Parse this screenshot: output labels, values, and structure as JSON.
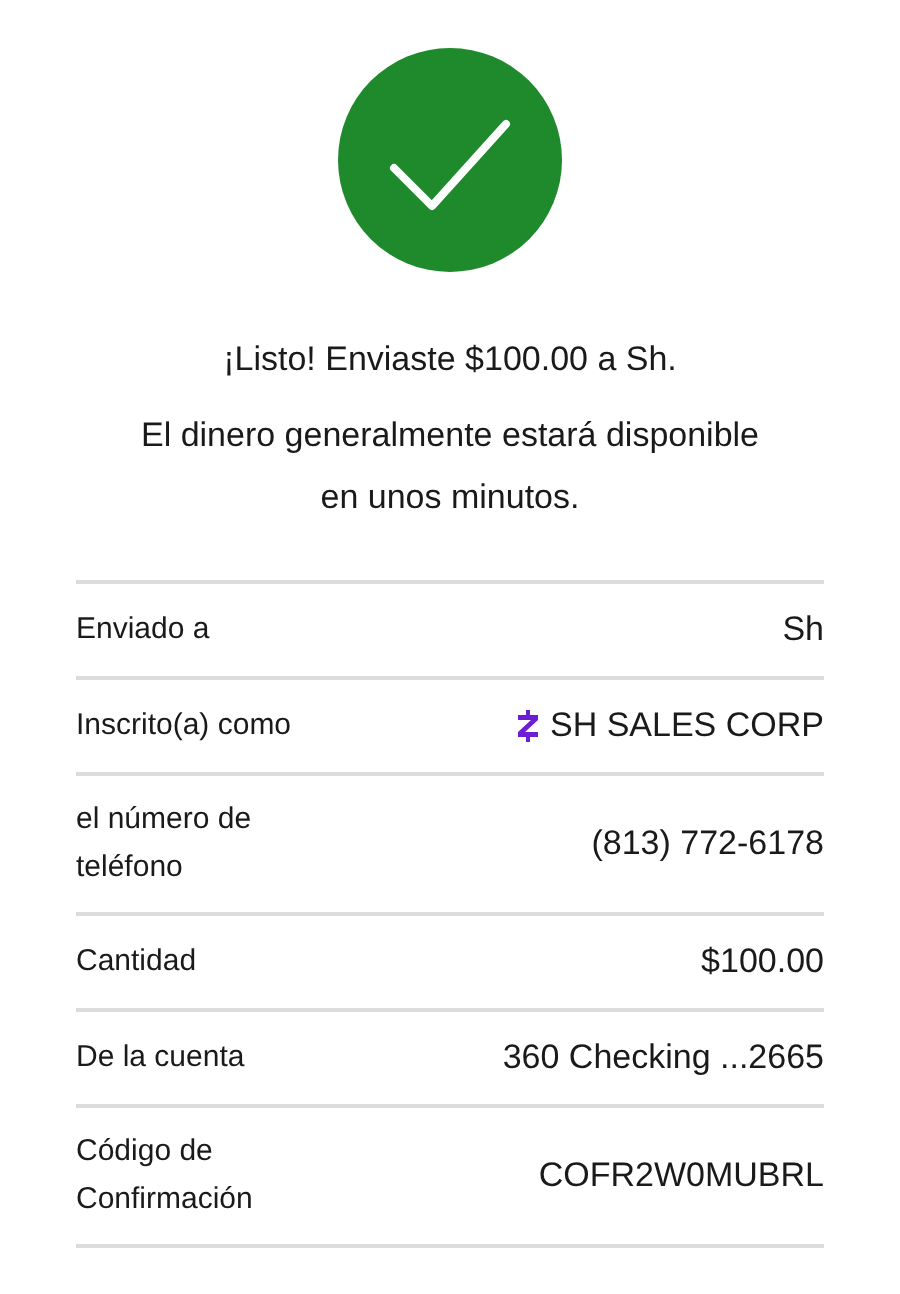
{
  "status": {
    "kind": "success"
  },
  "headline": "¡Listo! Enviaste $100.00 a Sh.",
  "message": "El dinero generalmente estará disponible\nen unos minutos.",
  "details": [
    {
      "label": "Enviado a",
      "value": "Sh",
      "kind": "plain"
    },
    {
      "label": "Inscrito(a) como",
      "value": "SH SALES CORP",
      "kind": "zelle"
    },
    {
      "label": "el número de\nteléfono",
      "value": "(813) 772-6178",
      "kind": "plain"
    },
    {
      "label": "Cantidad",
      "value": "$100.00",
      "kind": "plain"
    },
    {
      "label": "De la cuenta",
      "value": "360 Checking ...2665",
      "kind": "plain"
    },
    {
      "label": "Código de\nConfirmación",
      "value": "COFR2W0MUBRL",
      "kind": "plain"
    }
  ]
}
